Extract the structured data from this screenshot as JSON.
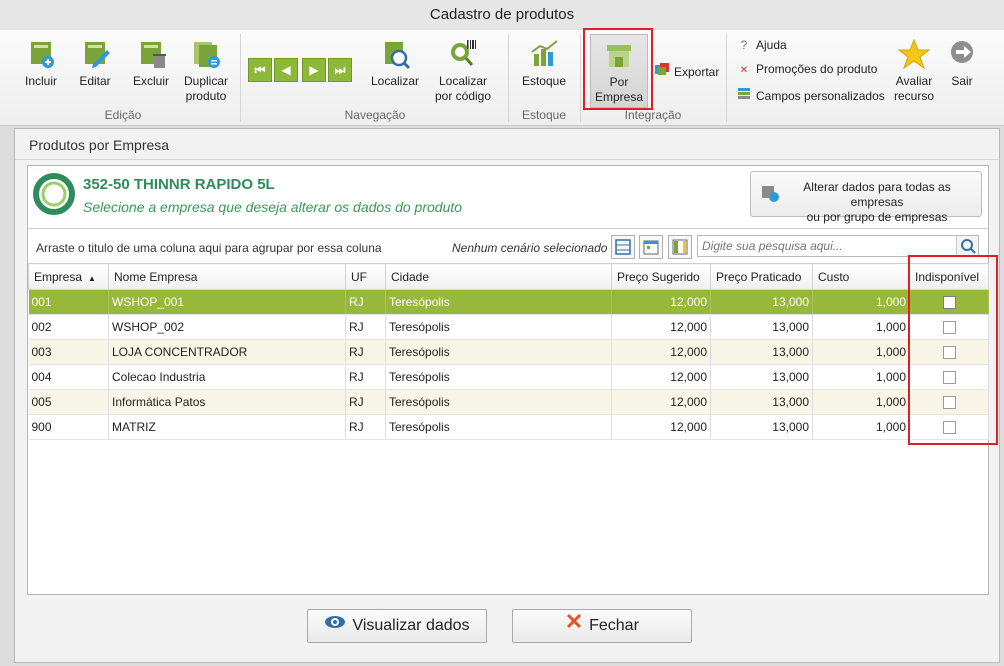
{
  "window": {
    "title": "Cadastro de produtos"
  },
  "ribbon": {
    "edicao": {
      "label": "Edição",
      "incluir": "Incluir",
      "editar": "Editar",
      "excluir": "Excluir",
      "duplicar_1": "Duplicar",
      "duplicar_2": "produto"
    },
    "navegacao": {
      "label": "Navegação",
      "localizar": "Localizar",
      "localizar_codigo_1": "Localizar",
      "localizar_codigo_2": "por código"
    },
    "estoque": {
      "label": "Estoque",
      "button": "Estoque"
    },
    "integracao": {
      "label": "Integração",
      "por_empresa_1": "Por",
      "por_empresa_2": "Empresa",
      "exportar": "Exportar"
    },
    "extras": {
      "ajuda": "Ajuda",
      "promocoes": "Promoções do produto",
      "campos": "Campos personalizados",
      "avaliar_1": "Avaliar",
      "avaliar_2": "recurso",
      "sair": "Sair"
    }
  },
  "panel": {
    "title": "Produtos por Empresa",
    "product_title": "352-50 THINNR RAPIDO 5L",
    "product_subtitle": "Selecione a empresa que deseja alterar os dados do produto",
    "alter_button_1": "Alterar dados para todas as empresas",
    "alter_button_2": "ou por grupo de empresas",
    "group_hint": "Arraste o titulo de uma coluna aqui para agrupar por essa coluna",
    "scenario": "Nenhum cenário selecionado",
    "search_placeholder": "Digite sua pesquisa aqui..."
  },
  "grid": {
    "columns": [
      "Empresa",
      "Nome Empresa",
      "UF",
      "Cidade",
      "Preço Sugerido",
      "Preço Praticado",
      "Custo",
      "Indisponível"
    ],
    "rows": [
      {
        "empresa": "001",
        "nome": "WSHOP_001",
        "uf": "RJ",
        "cidade": "Teresópolis",
        "sugerido": "12,000",
        "praticado": "13,000",
        "custo": "1,000"
      },
      {
        "empresa": "002",
        "nome": "WSHOP_002",
        "uf": "RJ",
        "cidade": "Teresópolis",
        "sugerido": "12,000",
        "praticado": "13,000",
        "custo": "1,000"
      },
      {
        "empresa": "003",
        "nome": "LOJA CONCENTRADOR",
        "uf": "RJ",
        "cidade": "Teresópolis",
        "sugerido": "12,000",
        "praticado": "13,000",
        "custo": "1,000"
      },
      {
        "empresa": "004",
        "nome": "Colecao Industria",
        "uf": "RJ",
        "cidade": "Teresópolis",
        "sugerido": "12,000",
        "praticado": "13,000",
        "custo": "1,000"
      },
      {
        "empresa": "005",
        "nome": "Informática Patos",
        "uf": "RJ",
        "cidade": "Teresópolis",
        "sugerido": "12,000",
        "praticado": "13,000",
        "custo": "1,000"
      },
      {
        "empresa": "900",
        "nome": "MATRIZ",
        "uf": "RJ",
        "cidade": "Teresópolis",
        "sugerido": "12,000",
        "praticado": "13,000",
        "custo": "1,000"
      }
    ]
  },
  "footer": {
    "visualizar": "Visualizar dados",
    "fechar": "Fechar"
  },
  "colors": {
    "accent_green": "#98b83b",
    "title_green": "#2e8c5a",
    "highlight_red": "#e02020"
  }
}
